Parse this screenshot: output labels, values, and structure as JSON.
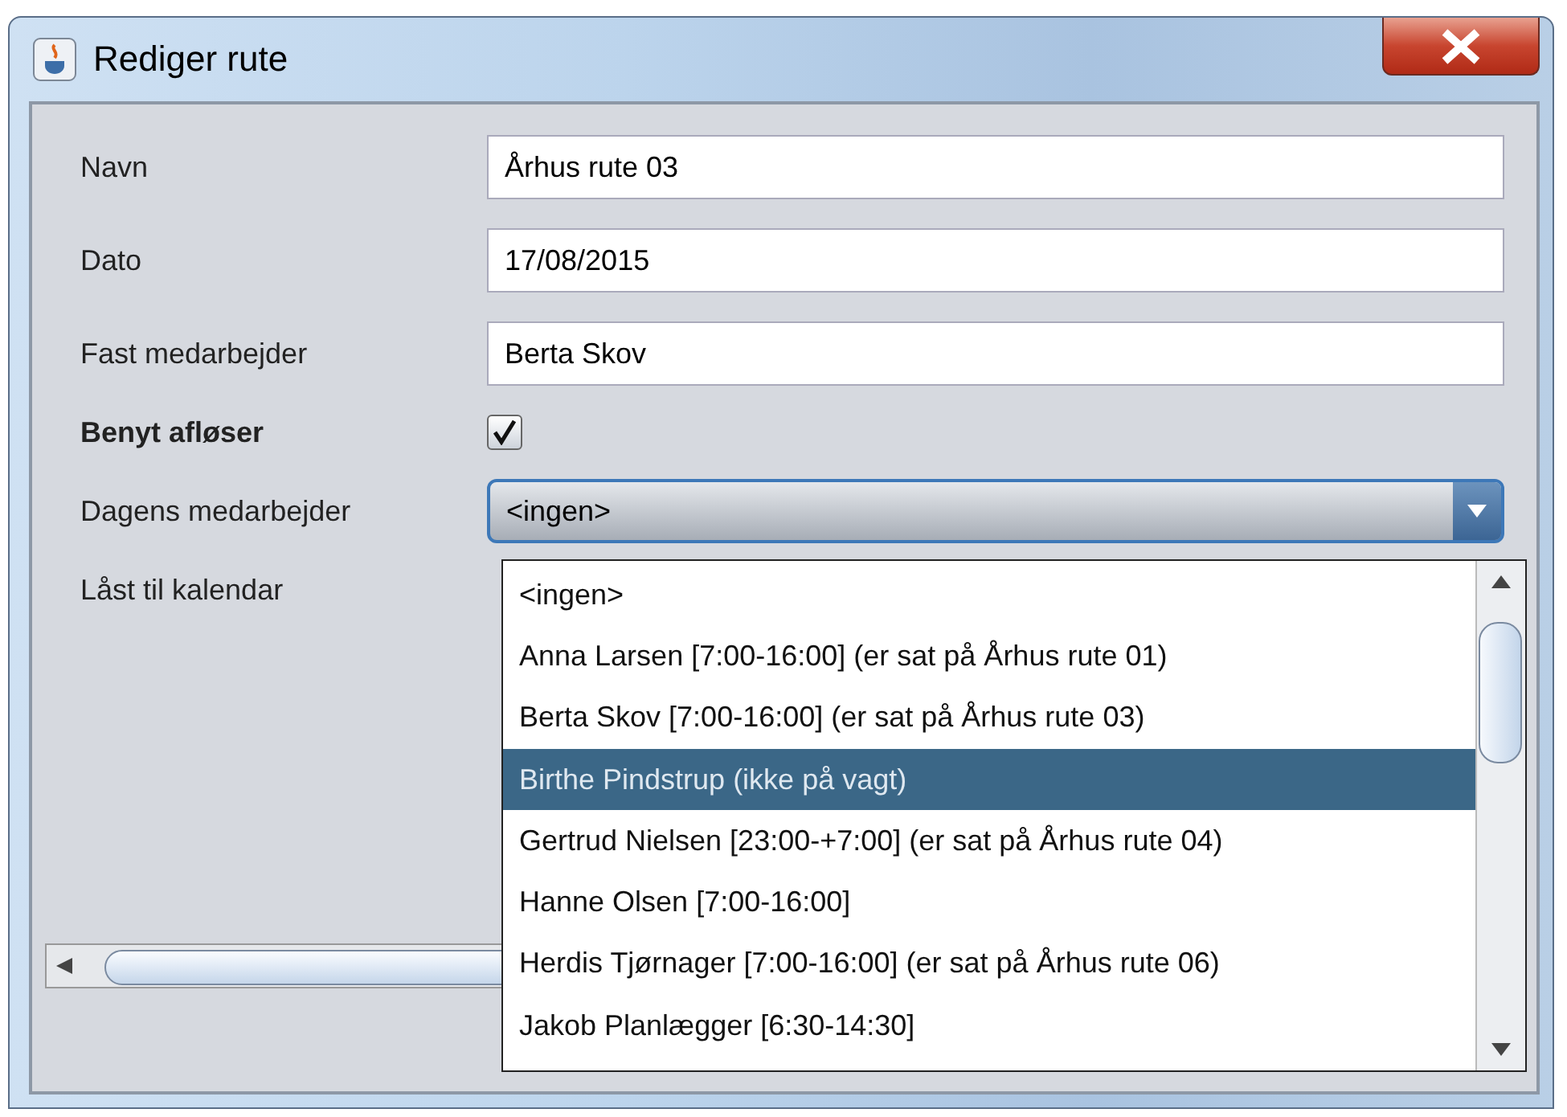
{
  "window": {
    "title": "Rediger rute"
  },
  "fields": [
    {
      "kind": "text",
      "label": "Navn",
      "value": "Århus rute 03"
    },
    {
      "kind": "text",
      "label": "Dato",
      "value": "17/08/2015"
    },
    {
      "kind": "text",
      "label": "Fast medarbejder",
      "value": "Berta Skov"
    },
    {
      "kind": "checkbox",
      "label": "Benyt afløser",
      "checked": true
    },
    {
      "kind": "combo",
      "label": "Dagens medarbejder",
      "value": "<ingen>",
      "expanded": true
    },
    {
      "kind": "label",
      "label": "Låst til kalendar"
    }
  ],
  "dropdown": {
    "items": [
      {
        "label": "<ingen>",
        "selected": false
      },
      {
        "label": "Anna Larsen [7:00-16:00] (er sat på Århus rute 01)",
        "selected": false
      },
      {
        "label": "Berta Skov [7:00-16:00] (er sat på Århus rute 03)",
        "selected": false
      },
      {
        "label": "Birthe Pindstrup (ikke på vagt)",
        "selected": true
      },
      {
        "label": "Gertrud Nielsen [23:00-+7:00] (er sat på Århus rute 04)",
        "selected": false
      },
      {
        "label": "Hanne Olsen [7:00-16:00]",
        "selected": false
      },
      {
        "label": "Herdis Tjørnager [7:00-16:00] (er sat på Århus rute 06)",
        "selected": false
      },
      {
        "label": "Jakob Planlægger [6:30-14:30]",
        "selected": false
      }
    ]
  }
}
